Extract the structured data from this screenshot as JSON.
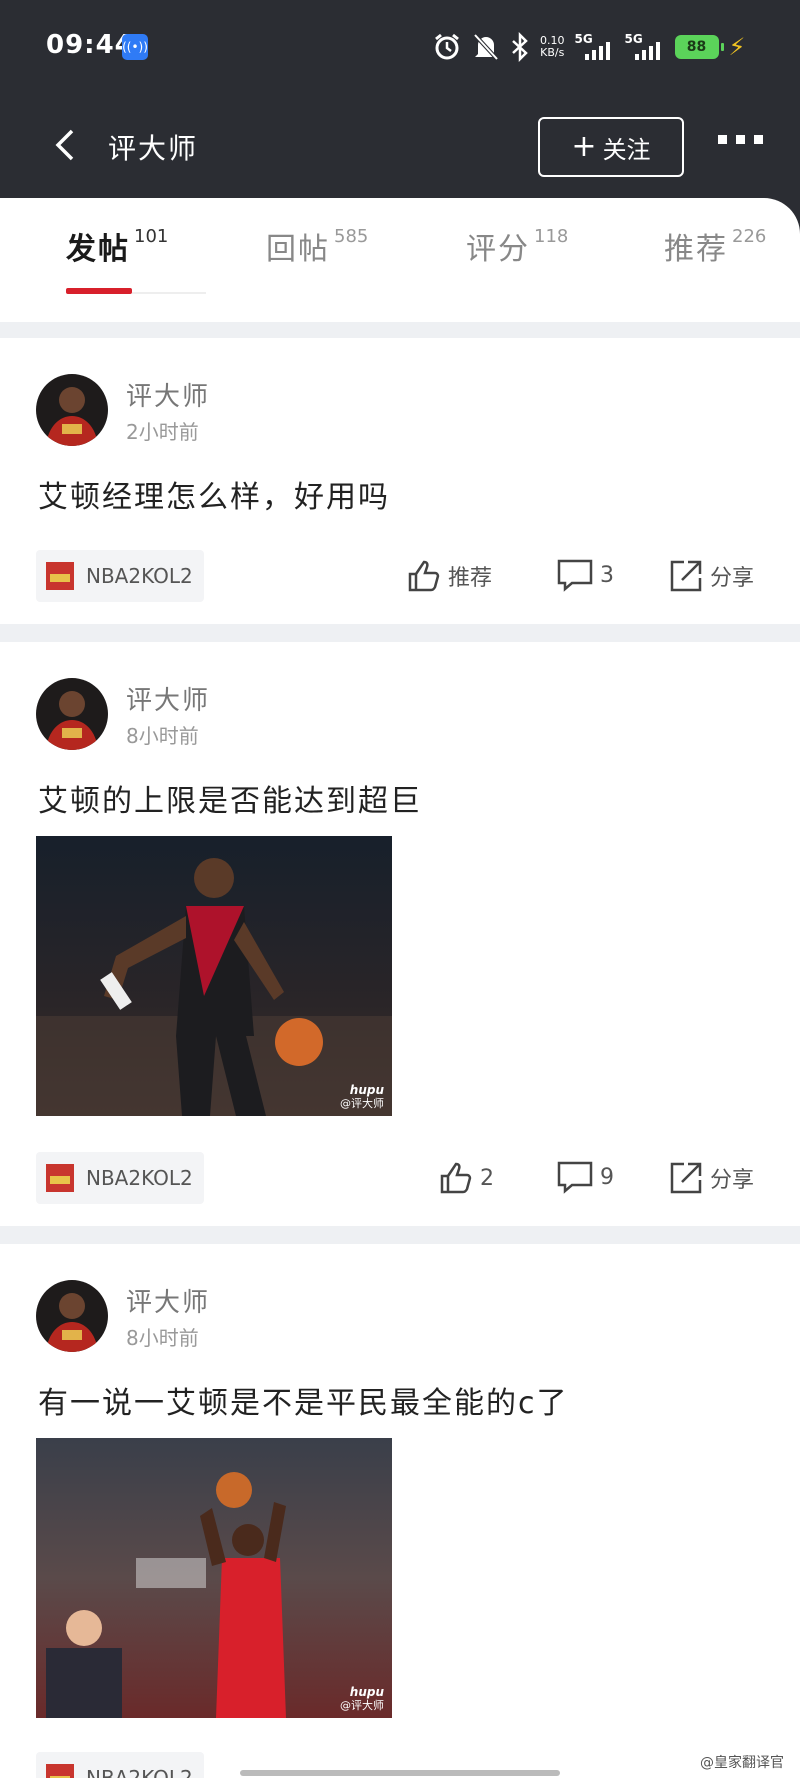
{
  "status_bar": {
    "time": "09:44",
    "net_speed": "0.10",
    "net_unit": "KB/s",
    "signal1": "5G",
    "signal2": "5G",
    "battery": "88"
  },
  "nav": {
    "title": "评大师",
    "follow_label": "关注"
  },
  "tabs": [
    {
      "label": "发帖",
      "count": "101"
    },
    {
      "label": "回帖",
      "count": "585"
    },
    {
      "label": "评分",
      "count": "118"
    },
    {
      "label": "推荐",
      "count": "226"
    }
  ],
  "posts": [
    {
      "author": "评大师",
      "time": "2小时前",
      "title": "艾顿经理怎么样，好用吗",
      "tag": "NBA2KOL2",
      "like_label": "推荐",
      "comments": "3",
      "share_label": "分享"
    },
    {
      "author": "评大师",
      "time": "8小时前",
      "title": "艾顿的上限是否能达到超巨",
      "image_watermark": "hupu",
      "image_credit": "@评大师",
      "tag": "NBA2KOL2",
      "like_label": "2",
      "comments": "9",
      "share_label": "分享"
    },
    {
      "author": "评大师",
      "time": "8小时前",
      "title": "有一说一艾顿是不是平民最全能的c了",
      "image_watermark": "hupu",
      "image_credit": "@评大师",
      "tag": "NBA2KOL2"
    }
  ],
  "footer_credit": "@皇家翻译官",
  "colors": {
    "header_bg": "#2b2d33",
    "accent": "#d8202b",
    "battery": "#5bd35a"
  }
}
